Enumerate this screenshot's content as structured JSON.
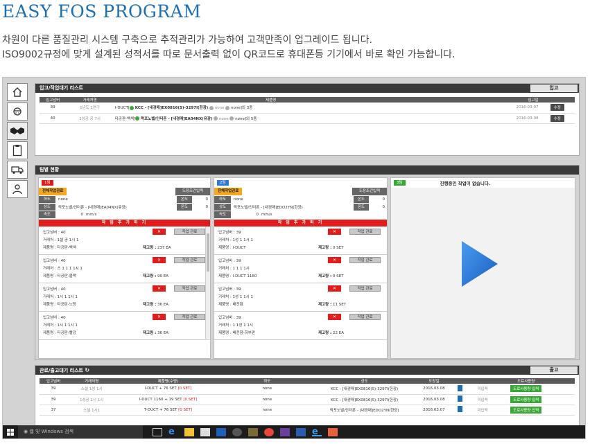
{
  "header": {
    "title": "EASY FOS PROGRAM",
    "line1": "차원이 다른 품질관리 시스템 구축으로 추적관리가 가능하여 고객만족이 업그레이드 됩니다.",
    "line2": "ISO9002규정에 맞게 설계된 성적서를 따로 문서출력 없이 QR코드로 휴대폰등 기기에서 바로 확인 가능합니다."
  },
  "sidebar": {
    "items": [
      "home-icon",
      "worker-icon",
      "handshake-icon",
      "clipboard-icon",
      "truck-icon",
      "user-icon"
    ]
  },
  "inbound": {
    "title": "입고/작업대기 리스트",
    "button": "입고",
    "cols": [
      "입고넘버",
      "거래처명",
      "제품명",
      "입고일"
    ],
    "rows": [
      {
        "no": "39",
        "client": "1년도 1연구",
        "product_prefix": "I-DUCT[",
        "product_main": "KCC - [내경매]EX0816(S)-3297I(한광)",
        "tail": "none",
        "tail2": "none]외 3종",
        "date": "2016-03-07",
        "action": "수정"
      },
      {
        "no": "40",
        "client": "1성공 공 7시",
        "product_prefix": "타공판-백색[",
        "product_main": "락포노벨/인터폰 - [내경매]EA04NX(유광)",
        "tail": "none",
        "tail2": "none]외 5종",
        "date": "2016-03-08",
        "action": "수정"
      }
    ]
  },
  "team": {
    "title": "팀별 현황"
  },
  "lane1": {
    "badge": "1팀",
    "tab": "전체작업관료",
    "tab2": "도장조건입력",
    "r1k": "하도",
    "r1v": "none",
    "r1k2": "온도",
    "r1v2": "0",
    "r2k": "상도",
    "r2v": "락포노벨/인터폰 - [내경매]EA04NX(유광)",
    "r2k2": "온도",
    "r2v2": "0",
    "r3k": "속도",
    "r3v": "0",
    "r3u": "mm/s",
    "bar": "작 업 추 가 하 기",
    "cards": [
      {
        "no": "입고넘버 : 40",
        "client": "거래처 : 1셀 공 1시 1",
        "prod": "제품명 : 타공판-백색",
        "stock_label": "재고량 :",
        "stock": "237 EA"
      },
      {
        "no": "입고넘버 : 40",
        "client": "거래처 : 스 1 1 1 1시 1",
        "prod": "제품명 : 타공판-블랙",
        "stock_label": "재고량 :",
        "stock": "90 EA"
      },
      {
        "no": "입고넘버 : 40",
        "client": "거래처 : 1시 1 1시 1",
        "prod": "제품명 : 타공판-노랑",
        "stock_label": "재고량 :",
        "stock": "36 EA"
      },
      {
        "no": "입고넘버 : 40",
        "client": "거래처 : 1시 1 1시 1",
        "prod": "제품명 : 타공판-빨강",
        "stock_label": "재고량 :",
        "stock": "36 EA"
      }
    ]
  },
  "lane2": {
    "badge": "2팀",
    "tab": "전체작업관료",
    "tab2": "도장조건입력",
    "r1k": "하도",
    "r1v": "none",
    "r1k2": "온도",
    "r1v2": "0",
    "r2k": "상도",
    "r2v": "락포노벨/인터폰 - [내경매]EDO2YN(한광)",
    "r2k2": "온도",
    "r2v2": "0",
    "r3k": "속도",
    "r3v": "0",
    "r3u": "mm/s",
    "bar": "작 업 추 가 하 기",
    "cards": [
      {
        "no": "입고넘버 : 39",
        "client": "거래처 : 1성 1 1시 1",
        "prod": "제품명 : I-DUCT",
        "stock_label": "재고량 :",
        "stock": "0 SET"
      },
      {
        "no": "입고넘버 : 39",
        "client": "거래처 : 1 1 1 1시",
        "prod": "제품명 : I-DUCT 1160",
        "stock_label": "재고량 :",
        "stock": "0 SET"
      },
      {
        "no": "입고넘버 : 39",
        "client": "거래처 : 1성 1 1시 1",
        "prod": "제품명 : 배전함",
        "stock_label": "재고량 :",
        "stock": "11 SET"
      },
      {
        "no": "입고넘버 : 39",
        "client": "거래처 : 1 1성 1 1시",
        "prod": "제품명 : 배전함-하부판",
        "stock_label": "재고량 :",
        "stock": "22 EA"
      }
    ]
  },
  "lane3": {
    "badge": "3팀",
    "text": "진행중인 작업이 없습니다."
  },
  "card_labels": {
    "x": "✕",
    "done": "작업 관료"
  },
  "outbound": {
    "title": "관료/출고대기 리스트",
    "button": "출고",
    "cols": [
      "입고넘버",
      "거래처명",
      "제품명(수량)",
      "하도",
      "상도",
      "도장일",
      "도료사용량"
    ],
    "rows": [
      {
        "no": "39",
        "client": "스셀 1성 1시",
        "product": "I-DUCT + 76 SET",
        "flag": "[0 SET]",
        "ha": "none",
        "sang": "KCC - [내경매]EX0816(S)-3297I(한광)",
        "date": "2016.03.08",
        "use": "미입력",
        "btn": "도료사용량 입력"
      },
      {
        "no": "39",
        "client": "1성공 1시 1시",
        "product": "I-DUCT 1160 + 19 SET",
        "flag": "[0 SET]",
        "ha": "none",
        "sang": "KCC - [내경매]EX0816(S)-3297I(한광)",
        "date": "2016.03.08",
        "use": "미입력",
        "btn": "도료사용량 입력"
      },
      {
        "no": "37",
        "client": "스셀 1시1",
        "product": "T-DUCT + 76 SET",
        "flag": "[0 SET]",
        "ha": "none",
        "sang": "락포노벨/인터폰 - [내경매]EDO2YN(한광)",
        "date": "2016.03.07",
        "use": "미입력",
        "btn": "도료사용량 입력"
      }
    ]
  },
  "taskbar": {
    "search": "웹 및 Windows 검색"
  },
  "colors": {
    "accent": "#1d6fb4",
    "red": "#e21b1b",
    "orange": "#f5a623",
    "green": "#3aa836",
    "blue": "#2d7ad6"
  }
}
